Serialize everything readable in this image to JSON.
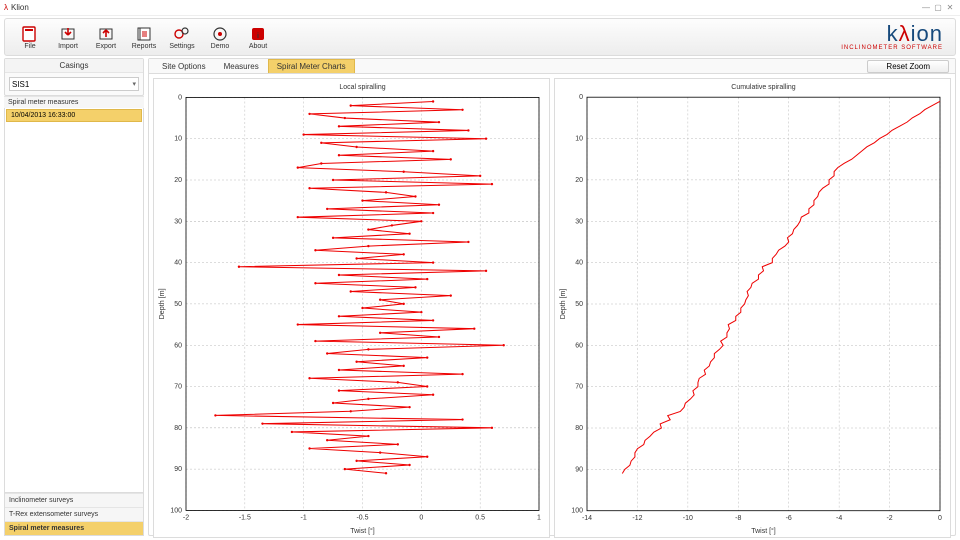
{
  "window": {
    "title": "Klion"
  },
  "brand": {
    "name_pre": "k",
    "name_accent": "λ",
    "name_post": "ion",
    "tagline": "INCLINOMETER SOFTWARE"
  },
  "toolbar": [
    {
      "id": "file",
      "label": "File"
    },
    {
      "id": "import",
      "label": "Import"
    },
    {
      "id": "export",
      "label": "Export"
    },
    {
      "id": "reports",
      "label": "Reports"
    },
    {
      "id": "settings",
      "label": "Settings"
    },
    {
      "id": "demo",
      "label": "Demo"
    },
    {
      "id": "about",
      "label": "About"
    }
  ],
  "sidebar": {
    "casings_header": "Casings",
    "casing_selected": "SIS1",
    "measures_header": "Spiral meter measures",
    "measures": [
      "10/04/2013 16:33:00"
    ],
    "accordion": [
      {
        "label": "Inclinometer surveys",
        "selected": false
      },
      {
        "label": "T-Rex extensometer surveys",
        "selected": false
      },
      {
        "label": "Spiral meter measures",
        "selected": true
      }
    ]
  },
  "tabs": {
    "items": [
      "Site Options",
      "Measures",
      "Spiral Meter Charts"
    ],
    "selected": 2,
    "reset_zoom": "Reset Zoom"
  },
  "chart_data": [
    {
      "type": "line",
      "title": "Local spiralling",
      "xlabel": "Twist [°]",
      "ylabel": "Depth [m]",
      "xlim": [
        -2,
        1
      ],
      "ylim": [
        0,
        100
      ],
      "y_inverted": true,
      "xticks": [
        -2,
        -1.5,
        -1,
        -0.5,
        0,
        0.5,
        1
      ],
      "yticks": [
        0,
        10,
        20,
        30,
        40,
        50,
        60,
        70,
        80,
        90,
        100
      ],
      "x": [
        0.1,
        -0.6,
        0.35,
        -0.95,
        -0.65,
        0.15,
        -0.7,
        0.4,
        -1.0,
        0.55,
        -0.85,
        -0.55,
        0.1,
        -0.7,
        0.25,
        -0.85,
        -1.05,
        -0.15,
        0.5,
        -0.75,
        0.6,
        -0.95,
        -0.3,
        -0.05,
        -0.5,
        0.15,
        -0.8,
        0.1,
        -1.05,
        0.0,
        -0.25,
        -0.45,
        -0.1,
        -0.75,
        0.4,
        -0.45,
        -0.9,
        -0.15,
        -0.55,
        0.1,
        -1.55,
        0.55,
        -0.7,
        0.05,
        -0.9,
        -0.05,
        -0.6,
        0.25,
        -0.35,
        -0.15,
        -0.5,
        0.0,
        -0.7,
        0.1,
        -1.05,
        0.45,
        -0.35,
        0.15,
        -0.9,
        0.7,
        -0.45,
        -0.8,
        0.05,
        -0.55,
        -0.15,
        -0.7,
        0.35,
        -0.95,
        -0.2,
        0.05,
        -0.7,
        0.1,
        -0.45,
        -0.75,
        -0.1,
        -0.6,
        -1.75,
        0.35,
        -1.35,
        0.6,
        -1.1,
        -0.45,
        -0.8,
        -0.2,
        -0.95,
        -0.35,
        0.05,
        -0.55,
        -0.1,
        -0.65,
        -0.3
      ],
      "y": [
        1,
        2,
        3,
        4,
        5,
        6,
        7,
        8,
        9,
        10,
        11,
        12,
        13,
        14,
        15,
        16,
        17,
        18,
        19,
        20,
        21,
        22,
        23,
        24,
        25,
        26,
        27,
        28,
        29,
        30,
        31,
        32,
        33,
        34,
        35,
        36,
        37,
        38,
        39,
        40,
        41,
        42,
        43,
        44,
        45,
        46,
        47,
        48,
        49,
        50,
        51,
        52,
        53,
        54,
        55,
        56,
        57,
        58,
        59,
        60,
        61,
        62,
        63,
        64,
        65,
        66,
        67,
        68,
        69,
        70,
        71,
        72,
        73,
        74,
        75,
        76,
        77,
        78,
        79,
        80,
        81,
        82,
        83,
        84,
        85,
        86,
        87,
        88,
        89,
        90,
        91
      ]
    },
    {
      "type": "line",
      "title": "Cumulative spiralling",
      "xlabel": "Twist [°]",
      "ylabel": "Depth [m]",
      "xlim": [
        -14,
        0
      ],
      "ylim": [
        0,
        100
      ],
      "y_inverted": true,
      "xticks": [
        -14,
        -12,
        -10,
        -8,
        -6,
        -4,
        -2,
        0
      ],
      "yticks": [
        0,
        10,
        20,
        30,
        40,
        50,
        60,
        70,
        80,
        90,
        100
      ],
      "x": [
        0.0,
        -0.3,
        -0.6,
        -0.8,
        -1.1,
        -1.3,
        -1.6,
        -1.9,
        -2.1,
        -2.4,
        -2.6,
        -2.9,
        -3.1,
        -3.3,
        -3.5,
        -3.8,
        -4.05,
        -4.2,
        -4.2,
        -4.4,
        -4.4,
        -4.65,
        -4.8,
        -4.85,
        -5.0,
        -5.0,
        -5.2,
        -5.2,
        -5.5,
        -5.55,
        -5.65,
        -5.8,
        -5.85,
        -6.05,
        -6.0,
        -6.15,
        -6.4,
        -6.5,
        -6.65,
        -6.65,
        -7.05,
        -7.0,
        -7.2,
        -7.2,
        -7.45,
        -7.5,
        -7.65,
        -7.6,
        -7.7,
        -7.75,
        -7.9,
        -7.9,
        -8.1,
        -8.1,
        -8.4,
        -8.35,
        -8.45,
        -8.45,
        -8.7,
        -8.6,
        -8.75,
        -8.95,
        -8.95,
        -9.1,
        -9.15,
        -9.35,
        -9.3,
        -9.55,
        -9.6,
        -9.6,
        -9.8,
        -9.75,
        -9.9,
        -10.1,
        -10.15,
        -10.3,
        -10.8,
        -10.7,
        -11.1,
        -11.05,
        -11.35,
        -11.5,
        -11.7,
        -11.75,
        -12.0,
        -12.1,
        -12.1,
        -12.25,
        -12.3,
        -12.5,
        -12.6
      ],
      "y": [
        1,
        2,
        3,
        4,
        5,
        6,
        7,
        8,
        9,
        10,
        11,
        12,
        13,
        14,
        15,
        16,
        17,
        18,
        19,
        20,
        21,
        22,
        23,
        24,
        25,
        26,
        27,
        28,
        29,
        30,
        31,
        32,
        33,
        34,
        35,
        36,
        37,
        38,
        39,
        40,
        41,
        42,
        43,
        44,
        45,
        46,
        47,
        48,
        49,
        50,
        51,
        52,
        53,
        54,
        55,
        56,
        57,
        58,
        59,
        60,
        61,
        62,
        63,
        64,
        65,
        66,
        67,
        68,
        69,
        70,
        71,
        72,
        73,
        74,
        75,
        76,
        77,
        78,
        79,
        80,
        81,
        82,
        83,
        84,
        85,
        86,
        87,
        88,
        89,
        90,
        91
      ]
    }
  ]
}
